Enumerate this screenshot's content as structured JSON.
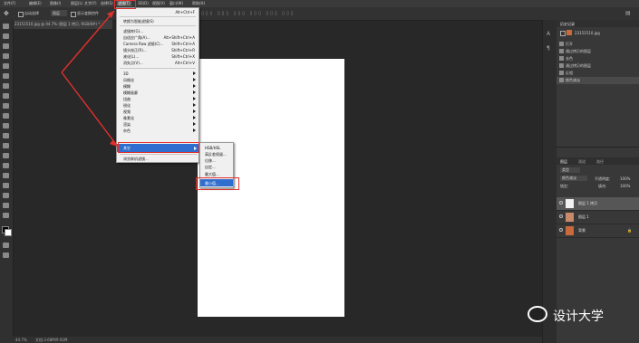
{
  "colors": {
    "accent_red": "#e0302c",
    "highlight_blue": "#2f6dcf",
    "canvas_bg": "#282828"
  },
  "menubar": {
    "items": [
      {
        "label": "文件(F)"
      },
      {
        "label": "编辑(E)"
      },
      {
        "label": "图像(I)"
      },
      {
        "label": "图层(L)"
      },
      {
        "label": "文字(Y)"
      },
      {
        "label": "选择(S)"
      },
      {
        "label": "滤镜(T)"
      },
      {
        "label": "3D(D)"
      },
      {
        "label": "视图(V)"
      },
      {
        "label": "窗口(W)"
      },
      {
        "label": "帮助(H)"
      }
    ]
  },
  "options_bar": {
    "auto_select": "自动选择",
    "group": "图层",
    "show_transform": "显示变换控件"
  },
  "document_tab": {
    "title": "23151510.jpg @ 44.7% (图层 1 拷贝, RGB/8#) *"
  },
  "filter_menu": {
    "last_filter": {
      "label": "",
      "shortcut": "Alt+Ctrl+F"
    },
    "smart_filters": {
      "label": "转换为智能滤镜(S)"
    },
    "group1": [
      {
        "label": "滤镜库(G)...",
        "shortcut": ""
      },
      {
        "label": "自适应广角(A)...",
        "shortcut": "Alt+Shift+Ctrl+A"
      },
      {
        "label": "Camera Raw 滤镜(C)...",
        "shortcut": "Shift+Ctrl+A"
      },
      {
        "label": "镜头校正(R)...",
        "shortcut": "Shift+Ctrl+R"
      },
      {
        "label": "液化(L)...",
        "shortcut": "Shift+Ctrl+X"
      },
      {
        "label": "消失点(V)...",
        "shortcut": "Alt+Ctrl+V"
      }
    ],
    "group2": [
      {
        "label": "3D"
      },
      {
        "label": "风格化"
      },
      {
        "label": "模糊"
      },
      {
        "label": "模糊画廊"
      },
      {
        "label": "扭曲"
      },
      {
        "label": "锐化"
      },
      {
        "label": "视频"
      },
      {
        "label": "像素化"
      },
      {
        "label": "渲染"
      },
      {
        "label": "杂色"
      },
      {
        "label": "其它"
      }
    ],
    "browse_online": {
      "label": "浏览联机滤镜..."
    }
  },
  "other_submenu": {
    "items": [
      {
        "label": "HSB/HSL"
      },
      {
        "label": "高反差保留..."
      },
      {
        "label": "位移..."
      },
      {
        "label": "自定..."
      },
      {
        "label": "最大值..."
      },
      {
        "label": "最小值..."
      }
    ]
  },
  "history_panel": {
    "tab_label": "历史记录",
    "snapshot": "23151510.jpg",
    "items": [
      {
        "label": "打开"
      },
      {
        "label": "通过拷贝的图层"
      },
      {
        "label": "去色"
      },
      {
        "label": "通过拷贝的图层"
      },
      {
        "label": "反相"
      },
      {
        "label": "颜色减淡"
      }
    ]
  },
  "layers_panel": {
    "tabs": [
      "图层",
      "通道",
      "路径"
    ],
    "kind_filter": "类型",
    "blend_mode": "颜色减淡",
    "opacity_label": "不透明度:",
    "opacity_value": "100%",
    "lock_label": "锁定:",
    "fill_label": "填充:",
    "fill_value": "100%",
    "layers": [
      {
        "name": "图层 1 拷贝"
      },
      {
        "name": "图层 1"
      },
      {
        "name": "背景"
      }
    ]
  },
  "status_bar": {
    "zoom": "44.7%",
    "doc": "文档:3.68M/9.92M"
  },
  "watermark": {
    "text": "设计大学"
  }
}
